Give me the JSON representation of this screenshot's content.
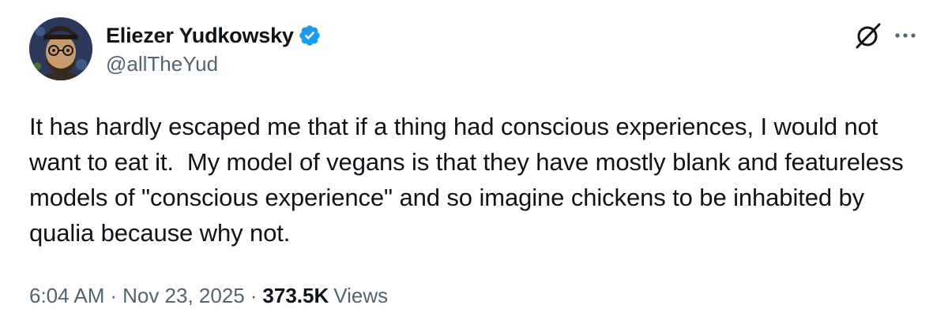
{
  "author": {
    "display_name": "Eliezer Yudkowsky",
    "handle": "@allTheYud",
    "verified": true,
    "verified_color": "#1d9bf0"
  },
  "tweet": {
    "text": "It has hardly escaped me that if a thing had conscious experiences, I would not want to eat it.  My model of vegans is that they have mostly blank and featureless models of \"conscious experience\" and so imagine chickens to be inhabited by qualia because why not."
  },
  "meta": {
    "time": "6:04 AM",
    "separator": "·",
    "date": "Nov 23, 2025",
    "views_count": "373.5K",
    "views_label": "Views"
  },
  "icons": {
    "avatar": "avatar-illustration",
    "verified": "verified-badge-icon",
    "grok": "grok-icon",
    "more": "more-icon"
  },
  "colors": {
    "text": "#0f1419",
    "secondary": "#536471",
    "accent": "#1d9bf0"
  }
}
